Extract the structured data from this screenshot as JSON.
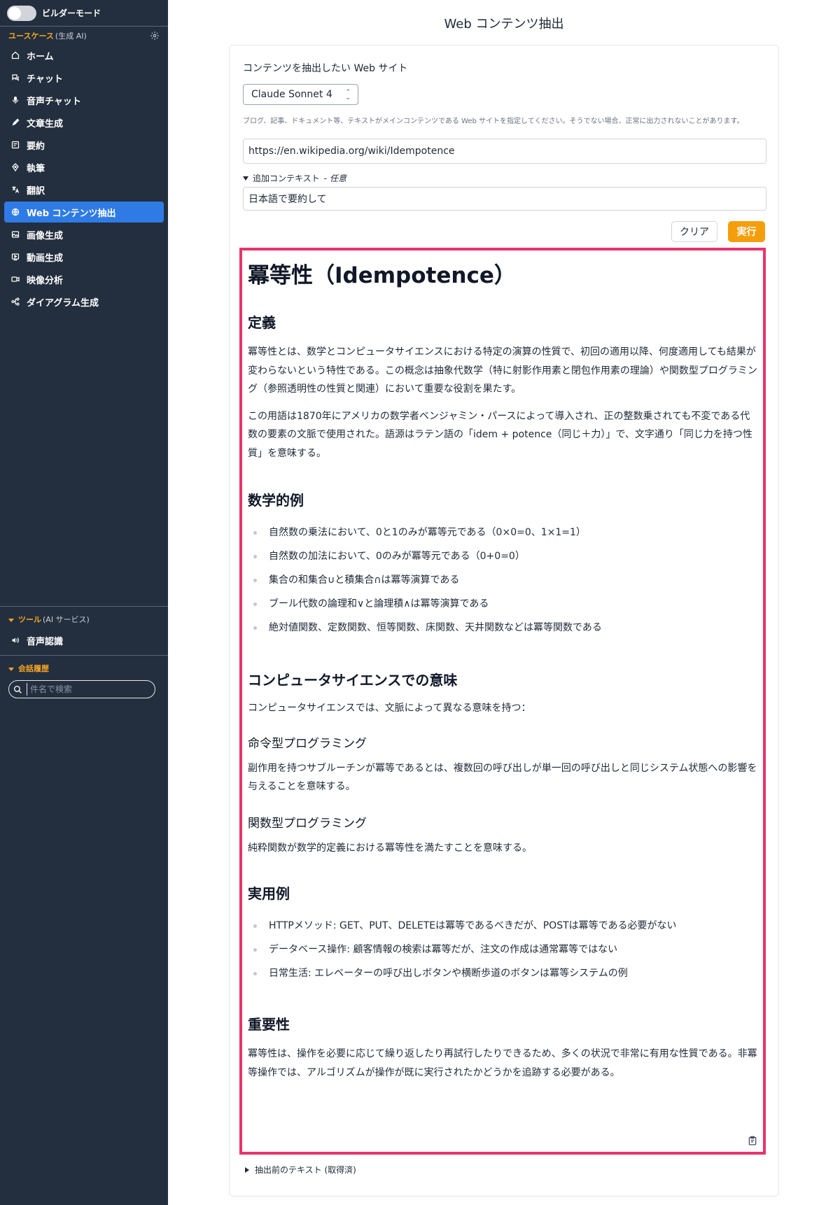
{
  "sidebar": {
    "builder_mode_label": "ビルダーモード",
    "usecase_title": "ユースケース",
    "usecase_sub": "(生成 AI)",
    "items": [
      {
        "label": "ホーム",
        "icon": "home-icon"
      },
      {
        "label": "チャット",
        "icon": "chat-icon"
      },
      {
        "label": "音声チャット",
        "icon": "microphone-icon"
      },
      {
        "label": "文章生成",
        "icon": "pencil-icon"
      },
      {
        "label": "要約",
        "icon": "summary-icon"
      },
      {
        "label": "執筆",
        "icon": "pen-nib-icon"
      },
      {
        "label": "翻訳",
        "icon": "translate-icon"
      },
      {
        "label": "Web コンテンツ抽出",
        "icon": "globe-icon",
        "active": true
      },
      {
        "label": "画像生成",
        "icon": "image-icon"
      },
      {
        "label": "動画生成",
        "icon": "video-icon"
      },
      {
        "label": "映像分析",
        "icon": "camera-icon"
      },
      {
        "label": "ダイアグラム生成",
        "icon": "diagram-icon"
      }
    ],
    "tools_title": "ツール",
    "tools_sub": "(AI サービス)",
    "tools_item": "音声認識",
    "history_title": "会話履歴",
    "search_placeholder": "件名で検索"
  },
  "main": {
    "title": "Web コンテンツ抽出",
    "site_label": "コンテンツを抽出したい Web サイト",
    "model": "Claude Sonnet 4",
    "hint": "ブログ、記事、ドキュメント等、テキストがメインコンテンツである Web サイトを指定してください。そうでない場合、正常に出力されないことがあります。",
    "url": "https://en.wikipedia.org/wiki/Idempotence",
    "context_label": "追加コンテキスト",
    "context_dash": "-",
    "context_optional": "任意",
    "context_value": "日本語で要約して",
    "clear_label": "クリア",
    "run_label": "実行",
    "before_text_label": "抽出前のテキスト (取得済)"
  },
  "result": {
    "h1": "冪等性（Idempotence）",
    "definition_heading": "定義",
    "definition_p1": "冪等性とは、数学とコンピュータサイエンスにおける特定の演算の性質で、初回の適用以降、何度適用しても結果が変わらないという特性である。この概念は抽象代数学（特に射影作用素と閉包作用素の理論）や関数型プログラミング（参照透明性の性質と関連）において重要な役割を果たす。",
    "definition_p2": "この用語は1870年にアメリカの数学者ベンジャミン・パースによって導入され、正の整数乗されても不変である代数の要素の文脈で使用された。語源はラテン語の「idem + potence（同じ＋力）」で、文字通り「同じ力を持つ性質」を意味する。",
    "math_heading": "数学的例",
    "math_items": [
      "自然数の乗法において、0と1のみが冪等元である（0×0=0、1×1=1）",
      "自然数の加法において、0のみが冪等元である（0+0=0）",
      "集合の和集合∪と積集合∩は冪等演算である",
      "ブール代数の論理和∨と論理積∧は冪等演算である",
      "絶対値関数、定数関数、恒等関数、床関数、天井関数などは冪等関数である"
    ],
    "cs_heading": "コンピュータサイエンスでの意味",
    "cs_intro": "コンピュータサイエンスでは、文脈によって異なる意味を持つ：",
    "imperative_heading": "命令型プログラミング",
    "imperative_p": "副作用を持つサブルーチンが冪等であるとは、複数回の呼び出しが単一回の呼び出しと同じシステム状態への影響を与えることを意味する。",
    "functional_heading": "関数型プログラミング",
    "functional_p": "純粋関数が数学的定義における冪等性を満たすことを意味する。",
    "practical_heading": "実用例",
    "practical_items": [
      "HTTPメソッド: GET、PUT、DELETEは冪等であるべきだが、POSTは冪等である必要がない",
      "データベース操作: 顧客情報の検索は冪等だが、注文の作成は通常冪等ではない",
      "日常生活: エレベーターの呼び出しボタンや横断歩道のボタンは冪等システムの例"
    ],
    "importance_heading": "重要性",
    "importance_p": "冪等性は、操作を必要に応じて繰り返したり再試行したりできるため、多くの状況で非常に有用な性質である。非冪等操作では、アルゴリズムが操作が既に実行されたかどうかを追跡する必要がある。"
  },
  "colors": {
    "sidebar_bg": "#232f3e",
    "active_item": "#2f7be6",
    "accent": "#f5a623",
    "run_button": "#f59e0b",
    "result_border": "#e8336b"
  }
}
